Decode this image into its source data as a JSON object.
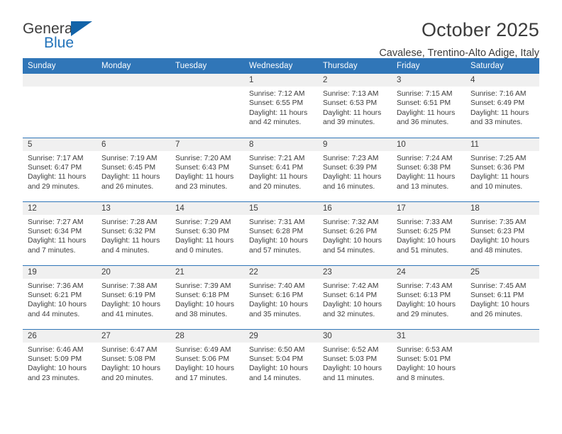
{
  "brand": {
    "name_part1": "General",
    "name_part2": "Blue",
    "flag_icon": "triangle-flag-icon"
  },
  "header": {
    "month_title": "October 2025",
    "location": "Cavalese, Trentino-Alto Adige, Italy"
  },
  "colors": {
    "header_blue": "#3076b8",
    "brand_blue": "#2273ba",
    "daynum_band": "#f0f0f0",
    "text": "#3c3c3c"
  },
  "calendar": {
    "weekday_headers": [
      "Sunday",
      "Monday",
      "Tuesday",
      "Wednesday",
      "Thursday",
      "Friday",
      "Saturday"
    ],
    "labels": {
      "sunrise": "Sunrise:",
      "sunset": "Sunset:",
      "daylight": "Daylight:"
    },
    "weeks": [
      [
        {
          "day": "",
          "blank": true
        },
        {
          "day": "",
          "blank": true
        },
        {
          "day": "",
          "blank": true
        },
        {
          "day": "1",
          "sunrise": "Sunrise: 7:12 AM",
          "sunset": "Sunset: 6:55 PM",
          "daylight_line1": "Daylight: 11 hours",
          "daylight_line2": "and 42 minutes."
        },
        {
          "day": "2",
          "sunrise": "Sunrise: 7:13 AM",
          "sunset": "Sunset: 6:53 PM",
          "daylight_line1": "Daylight: 11 hours",
          "daylight_line2": "and 39 minutes."
        },
        {
          "day": "3",
          "sunrise": "Sunrise: 7:15 AM",
          "sunset": "Sunset: 6:51 PM",
          "daylight_line1": "Daylight: 11 hours",
          "daylight_line2": "and 36 minutes."
        },
        {
          "day": "4",
          "sunrise": "Sunrise: 7:16 AM",
          "sunset": "Sunset: 6:49 PM",
          "daylight_line1": "Daylight: 11 hours",
          "daylight_line2": "and 33 minutes."
        }
      ],
      [
        {
          "day": "5",
          "sunrise": "Sunrise: 7:17 AM",
          "sunset": "Sunset: 6:47 PM",
          "daylight_line1": "Daylight: 11 hours",
          "daylight_line2": "and 29 minutes."
        },
        {
          "day": "6",
          "sunrise": "Sunrise: 7:19 AM",
          "sunset": "Sunset: 6:45 PM",
          "daylight_line1": "Daylight: 11 hours",
          "daylight_line2": "and 26 minutes."
        },
        {
          "day": "7",
          "sunrise": "Sunrise: 7:20 AM",
          "sunset": "Sunset: 6:43 PM",
          "daylight_line1": "Daylight: 11 hours",
          "daylight_line2": "and 23 minutes."
        },
        {
          "day": "8",
          "sunrise": "Sunrise: 7:21 AM",
          "sunset": "Sunset: 6:41 PM",
          "daylight_line1": "Daylight: 11 hours",
          "daylight_line2": "and 20 minutes."
        },
        {
          "day": "9",
          "sunrise": "Sunrise: 7:23 AM",
          "sunset": "Sunset: 6:39 PM",
          "daylight_line1": "Daylight: 11 hours",
          "daylight_line2": "and 16 minutes."
        },
        {
          "day": "10",
          "sunrise": "Sunrise: 7:24 AM",
          "sunset": "Sunset: 6:38 PM",
          "daylight_line1": "Daylight: 11 hours",
          "daylight_line2": "and 13 minutes."
        },
        {
          "day": "11",
          "sunrise": "Sunrise: 7:25 AM",
          "sunset": "Sunset: 6:36 PM",
          "daylight_line1": "Daylight: 11 hours",
          "daylight_line2": "and 10 minutes."
        }
      ],
      [
        {
          "day": "12",
          "sunrise": "Sunrise: 7:27 AM",
          "sunset": "Sunset: 6:34 PM",
          "daylight_line1": "Daylight: 11 hours",
          "daylight_line2": "and 7 minutes."
        },
        {
          "day": "13",
          "sunrise": "Sunrise: 7:28 AM",
          "sunset": "Sunset: 6:32 PM",
          "daylight_line1": "Daylight: 11 hours",
          "daylight_line2": "and 4 minutes."
        },
        {
          "day": "14",
          "sunrise": "Sunrise: 7:29 AM",
          "sunset": "Sunset: 6:30 PM",
          "daylight_line1": "Daylight: 11 hours",
          "daylight_line2": "and 0 minutes."
        },
        {
          "day": "15",
          "sunrise": "Sunrise: 7:31 AM",
          "sunset": "Sunset: 6:28 PM",
          "daylight_line1": "Daylight: 10 hours",
          "daylight_line2": "and 57 minutes."
        },
        {
          "day": "16",
          "sunrise": "Sunrise: 7:32 AM",
          "sunset": "Sunset: 6:26 PM",
          "daylight_line1": "Daylight: 10 hours",
          "daylight_line2": "and 54 minutes."
        },
        {
          "day": "17",
          "sunrise": "Sunrise: 7:33 AM",
          "sunset": "Sunset: 6:25 PM",
          "daylight_line1": "Daylight: 10 hours",
          "daylight_line2": "and 51 minutes."
        },
        {
          "day": "18",
          "sunrise": "Sunrise: 7:35 AM",
          "sunset": "Sunset: 6:23 PM",
          "daylight_line1": "Daylight: 10 hours",
          "daylight_line2": "and 48 minutes."
        }
      ],
      [
        {
          "day": "19",
          "sunrise": "Sunrise: 7:36 AM",
          "sunset": "Sunset: 6:21 PM",
          "daylight_line1": "Daylight: 10 hours",
          "daylight_line2": "and 44 minutes."
        },
        {
          "day": "20",
          "sunrise": "Sunrise: 7:38 AM",
          "sunset": "Sunset: 6:19 PM",
          "daylight_line1": "Daylight: 10 hours",
          "daylight_line2": "and 41 minutes."
        },
        {
          "day": "21",
          "sunrise": "Sunrise: 7:39 AM",
          "sunset": "Sunset: 6:18 PM",
          "daylight_line1": "Daylight: 10 hours",
          "daylight_line2": "and 38 minutes."
        },
        {
          "day": "22",
          "sunrise": "Sunrise: 7:40 AM",
          "sunset": "Sunset: 6:16 PM",
          "daylight_line1": "Daylight: 10 hours",
          "daylight_line2": "and 35 minutes."
        },
        {
          "day": "23",
          "sunrise": "Sunrise: 7:42 AM",
          "sunset": "Sunset: 6:14 PM",
          "daylight_line1": "Daylight: 10 hours",
          "daylight_line2": "and 32 minutes."
        },
        {
          "day": "24",
          "sunrise": "Sunrise: 7:43 AM",
          "sunset": "Sunset: 6:13 PM",
          "daylight_line1": "Daylight: 10 hours",
          "daylight_line2": "and 29 minutes."
        },
        {
          "day": "25",
          "sunrise": "Sunrise: 7:45 AM",
          "sunset": "Sunset: 6:11 PM",
          "daylight_line1": "Daylight: 10 hours",
          "daylight_line2": "and 26 minutes."
        }
      ],
      [
        {
          "day": "26",
          "sunrise": "Sunrise: 6:46 AM",
          "sunset": "Sunset: 5:09 PM",
          "daylight_line1": "Daylight: 10 hours",
          "daylight_line2": "and 23 minutes."
        },
        {
          "day": "27",
          "sunrise": "Sunrise: 6:47 AM",
          "sunset": "Sunset: 5:08 PM",
          "daylight_line1": "Daylight: 10 hours",
          "daylight_line2": "and 20 minutes."
        },
        {
          "day": "28",
          "sunrise": "Sunrise: 6:49 AM",
          "sunset": "Sunset: 5:06 PM",
          "daylight_line1": "Daylight: 10 hours",
          "daylight_line2": "and 17 minutes."
        },
        {
          "day": "29",
          "sunrise": "Sunrise: 6:50 AM",
          "sunset": "Sunset: 5:04 PM",
          "daylight_line1": "Daylight: 10 hours",
          "daylight_line2": "and 14 minutes."
        },
        {
          "day": "30",
          "sunrise": "Sunrise: 6:52 AM",
          "sunset": "Sunset: 5:03 PM",
          "daylight_line1": "Daylight: 10 hours",
          "daylight_line2": "and 11 minutes."
        },
        {
          "day": "31",
          "sunrise": "Sunrise: 6:53 AM",
          "sunset": "Sunset: 5:01 PM",
          "daylight_line1": "Daylight: 10 hours",
          "daylight_line2": "and 8 minutes."
        },
        {
          "day": "",
          "blank": true
        }
      ]
    ]
  }
}
